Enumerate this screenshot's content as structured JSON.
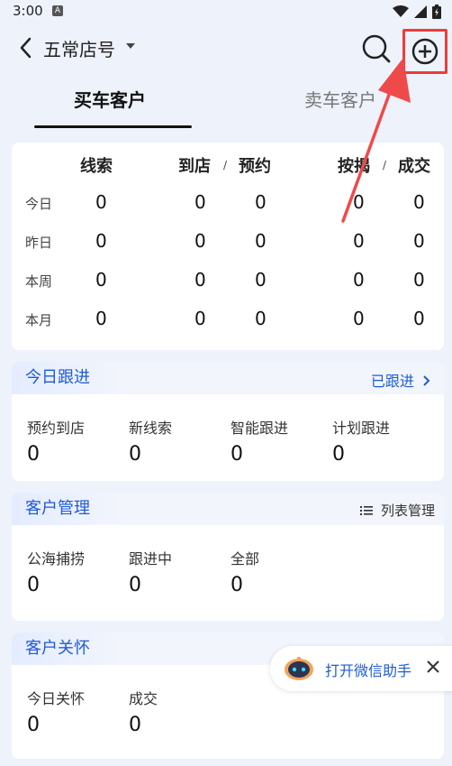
{
  "status_bar": {
    "time": "3:00",
    "notif_letter": "A"
  },
  "header": {
    "title": "五常店号"
  },
  "tabs": [
    {
      "label": "买车客户"
    },
    {
      "label": "卖车客户"
    }
  ],
  "stats": {
    "columns": [
      "线索",
      "到店",
      "预约",
      "按揭",
      "成交"
    ],
    "slash": "/",
    "rows": [
      {
        "label": "今日",
        "values": [
          "0",
          "0",
          "0",
          "0",
          "0"
        ]
      },
      {
        "label": "昨日",
        "values": [
          "0",
          "0",
          "0",
          "0",
          "0"
        ]
      },
      {
        "label": "本周",
        "values": [
          "0",
          "0",
          "0",
          "0",
          "0"
        ]
      },
      {
        "label": "本月",
        "values": [
          "0",
          "0",
          "0",
          "0",
          "0"
        ]
      }
    ]
  },
  "followup": {
    "title": "今日跟进",
    "link": "已跟进",
    "items": [
      {
        "label": "预约到店",
        "value": "0"
      },
      {
        "label": "新线索",
        "value": "0"
      },
      {
        "label": "智能跟进",
        "value": "0"
      },
      {
        "label": "计划跟进",
        "value": "0"
      }
    ]
  },
  "manage": {
    "title": "客户管理",
    "link": "列表管理",
    "items": [
      {
        "label": "公海捕捞",
        "value": "0"
      },
      {
        "label": "跟进中",
        "value": "0"
      },
      {
        "label": "全部",
        "value": "0"
      }
    ]
  },
  "care": {
    "title": "客户关怀",
    "items": [
      {
        "label": "今日关怀",
        "value": "0"
      },
      {
        "label": "成交",
        "value": "0"
      }
    ]
  },
  "assistant": {
    "label": "打开微信助手"
  },
  "colors": {
    "accent": "#1e5bd8",
    "highlight": "#ef3b3b",
    "background": "#eef2fb"
  }
}
